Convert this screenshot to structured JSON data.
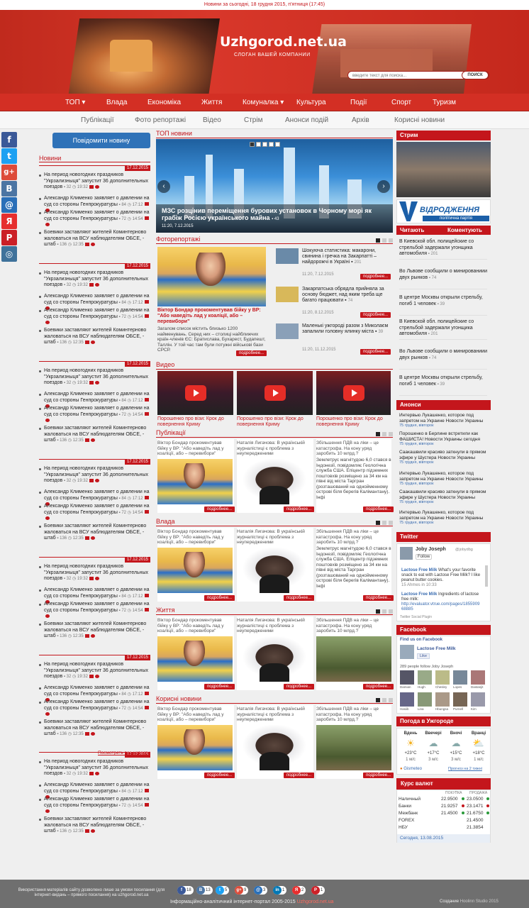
{
  "topbar": {
    "news_today": "Новини за сьогодні, 18 грудня 2015, п'ятниця (17:45)"
  },
  "header": {
    "site_name": "Uzhgorod.net.ua",
    "slogan": "СЛОГАН ВАШЕЙ КОМПАНИИ",
    "search_placeholder": "введите текст для поиска...",
    "search_button": "ПОИСК"
  },
  "nav_main": [
    "ТОП ▾",
    "Влада",
    "Економіка",
    "Життя",
    "Комуналка ▾",
    "Культура",
    "Події",
    "Спорт",
    "Туризм"
  ],
  "nav_sub": [
    "Публікації",
    "Фото репортажі",
    "Відео",
    "Стрім",
    "Анонси подій",
    "Архів",
    "Корисні новини"
  ],
  "social_side": [
    "f",
    "t",
    "g+",
    "B",
    "@",
    "Я",
    "P",
    "◎"
  ],
  "report_button": "Повідомити новину",
  "left": {
    "news_head": "Новини",
    "date": "17.12.2015",
    "items": [
      {
        "text": "На период новогодних праздников \"Укрзализныця\" запустит 36 дополнительных поездов",
        "count": "32",
        "time": "19:32"
      },
      {
        "text": "Александр Клименко заявляет о давлении на суд со стороны Генпрокуратуры",
        "count": "84",
        "time": "17:12"
      },
      {
        "text": "Александр Клименко заявляет о давлении на суд со стороны Генпрокуратуры",
        "count": "72",
        "time": "14:54"
      },
      {
        "text": "Боевики заставляют жителей Коминтерново жаловаться на ВСУ наблюдателям ОБСЕ, - штаб",
        "count": "136",
        "time": "12:35"
      }
    ],
    "all_news": "Посмотреть все новости"
  },
  "center": {
    "top_head": "ТОП новини",
    "slider": {
      "title": "МЗС розцінив переміщення бурових установок в Чорному морі як грабіж Росією українського майна",
      "count": "43",
      "meta": "11:20, 7.12.2015"
    },
    "photo_head": "Фоторепортажі",
    "photo_main": {
      "title": "Віктор Бондар прокоментував бійку у ВР: \"Або наведіть лад у коаліції, або – перевибори\"",
      "text": "Загалом список містить близько 1200 найменувань. Серед них – столиці найближчих країн-членів ЄС: Братислава, Бухарест, Будапешт, Таллін. У той час там були потужні військові бази СРСР."
    },
    "photo_list": [
      {
        "title": "Шокуюча статистика: макарони, свинина і гречка на Закарпатті – найдорожчі в Україні",
        "count": "201",
        "meta": "11:20, 7.12.2015"
      },
      {
        "title": "Закарпатська обрядла прийняла за основу бюджет, над яким треба ще багато працювати",
        "count": "74",
        "meta": "11:20, 8.12.2015"
      },
      {
        "title": "Маленькі ужгороді разом з Миколаєм запалили головну ялинку міста",
        "count": "39",
        "meta": "11:20, 11.12.2015"
      }
    ],
    "more": "подробнее...",
    "video_head": "Видео",
    "video_caption": "Порошенко про візи: Крок до повернення Криму",
    "cards": [
      {
        "title": "Віктор Бондар прокоментував бійку у ВР: \"Або наведіть лад у коаліції, або – перевибори\""
      },
      {
        "title": "Наталія Лигачова: В українській журналістиці є проблема з неупередженими"
      },
      {
        "title": "Збільшення ПДВ на ліки – це катастрофа. На кону уряд заробить 10 млрд.?",
        "text": "Землетрус магнітудою 6,0 стався в Індонезії, повідомляє Геологічна служба США. Епіцентр підземних поштовхів розміщено за 34 км на півні від міста Таргран (розташований на однойменному острові біля берегів Калімантану). Інфі"
      }
    ],
    "sections": [
      "Публікації",
      "Влада",
      "Життя",
      "Корисні новини"
    ]
  },
  "right": {
    "stream_head": "Стрим",
    "party": "ВІДРОДЖЕННЯ",
    "party_sub": "політична партія",
    "tabs": [
      "Читають",
      "Коментують"
    ],
    "reading": [
      {
        "text": "В Киевской обл. полицейские со стрельбой задержали угонщика автомобиля",
        "count": "201"
      },
      {
        "text": "Во Львове сообщили о минированиии двух рынков",
        "count": "74"
      },
      {
        "text": "В центре Москвы открыли стрельбу, погиб 1 человек",
        "count": "39"
      },
      {
        "text": "В Киевской обл. полицейские со стрельбой задержали угонщика автомобиля",
        "count": "201"
      },
      {
        "text": "Во Львове сообщили о минированиии двух рынков",
        "count": "74"
      },
      {
        "text": "В центре Москвы открыли стрельбу, погиб 1 человек",
        "count": "39"
      }
    ],
    "announce_head": "Анонси",
    "announce": [
      {
        "text": "Интервью Лукашенко, которое под запретом на Украине Новости Украины",
        "src": "75 грудня, вівторок"
      },
      {
        "text": "Порошенко в Берлине встретили как ФАШИСТА! Новости Украины сегодня",
        "src": "75 грудня, вівторок"
      },
      {
        "text": "Саакашвили красиво заткнули в прямом эфире у Шустера Новости Украины",
        "src": "75 грудня, вівторок"
      },
      {
        "text": "Интервью Лукашенко, которое под запретом на Украине Новости Украины",
        "src": "75 грудня, вівторок"
      },
      {
        "text": "Саакашвили красиво заткнули в прямом эфире у Шустера Новости Украины",
        "src": "75 грудня, вівторок"
      },
      {
        "text": "Интервью Лукашенко, которое под запретом на Украине Новости Украины",
        "src": "75 грудня, вівторок"
      }
    ],
    "twitter_head": "Twitter",
    "twitter": {
      "name": "Joby Joseph",
      "handle": "@jobydbg",
      "follow": "Follow",
      "t1_user": "Lactose Free Milk",
      "t1": "What's your favorite snack to eat with Lactose Free Milk? I like peanut butter cookies.",
      "t1_time": "15 Ahmes in 10:33",
      "t2": "Ingredients of lactose free milk:",
      "t2_url": "http://evaluator.vtrue.com/pages/185590968885",
      "plugin": "Twitter Social Plugin"
    },
    "facebook_head": "Facebook",
    "facebook": {
      "find": "Find us on Facebook",
      "page": "Lactose Free Milk",
      "like": "Like",
      "follow_text": "289 people follow Joby Joseph",
      "people": [
        "Damian",
        "Hugh",
        "Chesley",
        "Lopes",
        "Dastanjit",
        "Hasiib",
        "Lina",
        "Hbungsa",
        "Purnell",
        "Kim"
      ]
    },
    "weather_head": "Погода в Ужгороде",
    "weather": {
      "days": [
        "Вдень",
        "Ввечері",
        "Вночі",
        "Вранці"
      ],
      "temps": [
        "+23°C",
        "+17°C",
        "+15°C",
        "+18°C"
      ],
      "winds": [
        "1 м/с",
        "3 м/с",
        "3 м/с",
        "1 м/с"
      ],
      "brand": "Gismeteo",
      "link": "Прогноз на 2 тижні"
    },
    "currency_head": "Курс валют",
    "currency": {
      "cols": [
        "ПОКУПКА",
        "ПРОДАЖА"
      ],
      "rows": [
        [
          "Наличный",
          "22.9500",
          "23.0500"
        ],
        [
          "Банки",
          "21.9257",
          "23.1471"
        ],
        [
          "Межбанк",
          "21.4500",
          "21.6750"
        ],
        [
          "FOREX",
          "",
          "21.4500"
        ],
        [
          "НБУ",
          "",
          "21.3854"
        ]
      ],
      "date": "Сегодня, 13.08.2015"
    }
  },
  "footer": {
    "copyright": "Використання матеріалів сайту дозволено лише за умови посилання (для інтернет-видань – прямого посилання) на uzhgorod.net.ua",
    "portal": "Інформаційно-аналітичний інтернет-портал 2005-2015",
    "site": "Uzhgorod.net.ua",
    "studio_label": "Создание",
    "studio": "Hoolinn Studio 2015",
    "social": [
      {
        "k": "f",
        "n": "18"
      },
      {
        "k": "B",
        "n": "13"
      },
      {
        "k": "t",
        "n": "5"
      },
      {
        "k": "g+",
        "n": "9"
      },
      {
        "k": "@",
        "n": "3"
      },
      {
        "k": "in",
        "n": "1"
      },
      {
        "k": "Я",
        "n": "2"
      },
      {
        "k": "P",
        "n": "1"
      }
    ]
  },
  "colors": {
    "accent": "#c4161c",
    "nav": "#d32f24",
    "button": "#2f72b8"
  }
}
